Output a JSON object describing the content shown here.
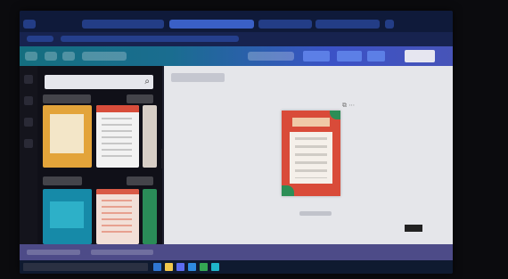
{
  "taskbar": {
    "search_placeholder": "",
    "app_icons": [
      "edge-icon",
      "file-explorer-icon",
      "store-icon",
      "mail-icon",
      "chrome-icon",
      "canva-icon"
    ],
    "app_icon_colors": [
      "#2f76d2",
      "#f2c84b",
      "#5c6cf0",
      "#2f8be0",
      "#34a853",
      "#1fb5c9"
    ]
  },
  "search": {
    "placeholder": "",
    "icon": "search-icon"
  },
  "colors": {
    "tab_bar": "#0f1a3a",
    "app_bar_start": "#146e7f",
    "app_bar_end": "#4754b8",
    "canvas_background": "#e5e6ea",
    "poster_red": "#d94b39",
    "footer_bar": "#4d4b88",
    "panel_background": "#101018"
  }
}
